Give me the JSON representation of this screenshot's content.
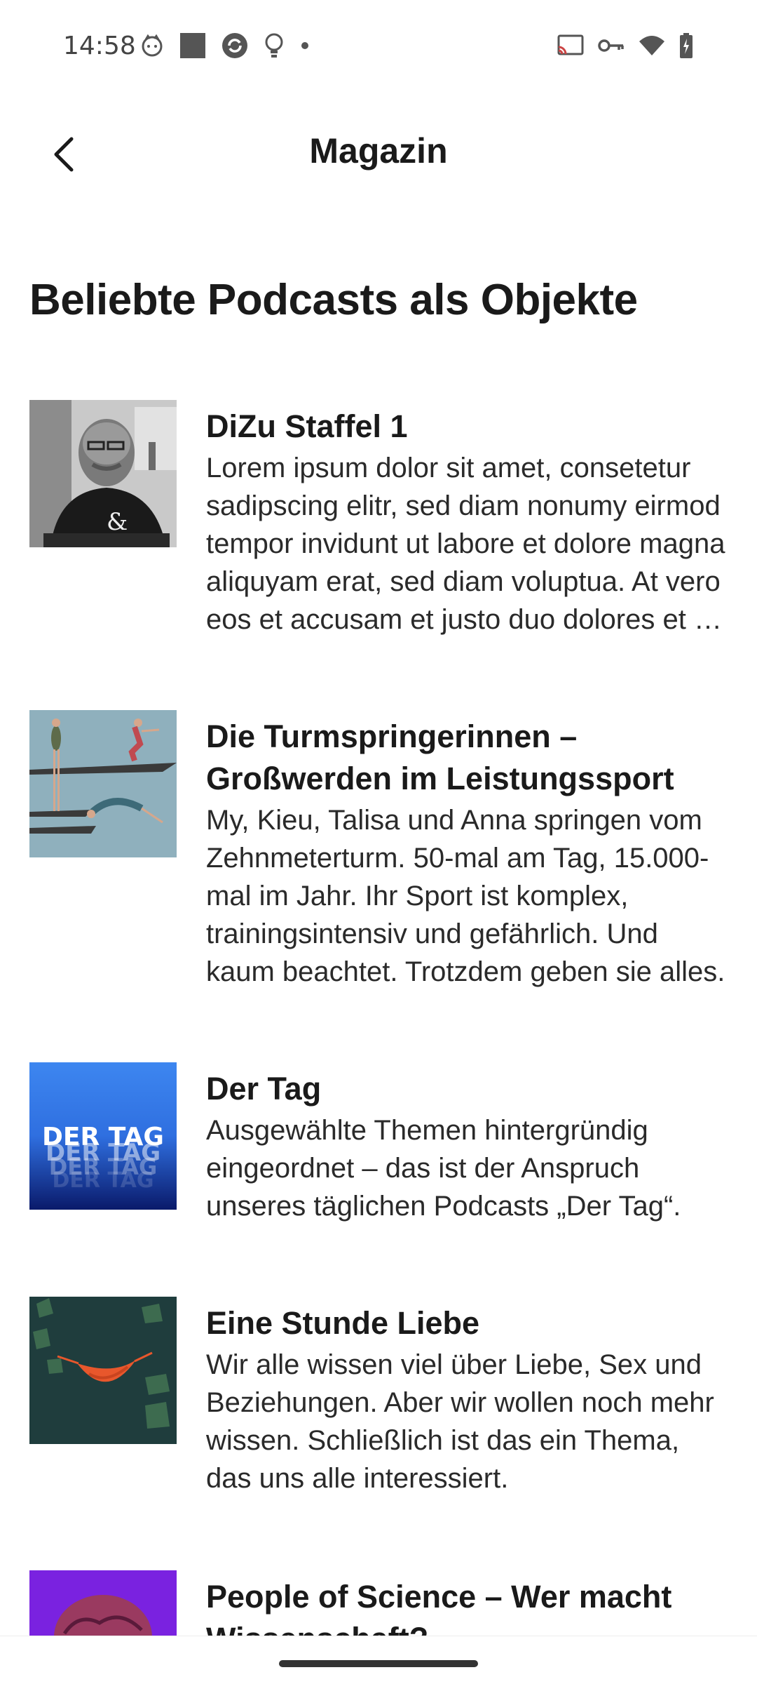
{
  "status_bar": {
    "time": "14:58",
    "left_icons": [
      "cat-face-icon",
      "square-icon",
      "sync-circle-icon",
      "lightbulb-icon",
      "dot-icon"
    ],
    "right_icons": [
      "cast-icon",
      "vpn-key-icon",
      "wifi-icon",
      "battery-charging-icon"
    ]
  },
  "header": {
    "title": "Magazin",
    "back_icon": "back-arrow-icon"
  },
  "section": {
    "title": "Beliebte Podcasts als Objekte"
  },
  "podcasts": [
    {
      "title": "DiZu Staffel 1",
      "description": "Lorem ipsum dolor sit amet, consetetur sadipscing elitr, sed diam nonumy eirmod tempor invidunt ut labore et dolore magna aliquyam erat, sed diam voluptua. At vero eos et accusam et justo duo dolores et ea rebum.",
      "thumb_alt": "portrait-photo"
    },
    {
      "title": "Die Turmspringerinnen – Großwerden im Leistungssport",
      "description": "My, Kieu, Talisa und Anna springen vom Zehnmeterturm. 50-mal am Tag, 15.000-mal im Jahr. Ihr Sport ist komplex, trainingsintensiv und gefährlich. Und kaum beachtet. Trotzdem geben sie alles.",
      "thumb_alt": "divers-illustration"
    },
    {
      "title": "Der Tag",
      "description": "Ausgewählte Themen hintergründig eingeordnet – das ist der Anspruch unseres täglichen Podcasts „Der Tag“.",
      "thumb_text": "DER TAG"
    },
    {
      "title": "Eine Stunde Liebe",
      "description": "Wir alle wissen viel über Liebe, Sex und Beziehungen. Aber wir wollen noch mehr wissen. Schließlich ist das ein Thema, das uns alle interessiert.",
      "thumb_alt": "hammock-illustration"
    },
    {
      "title": "People of Science – Wer macht Wissenschaft?",
      "description": "",
      "thumb_alt": "brain-illustration"
    }
  ],
  "colors": {
    "der_tag_blue": "#3d86f0",
    "liebe_bg": "#1f3d3d",
    "liebe_accent": "#e8572c",
    "turm_bg": "#8fb0bd",
    "science_purple": "#7a22e0"
  }
}
